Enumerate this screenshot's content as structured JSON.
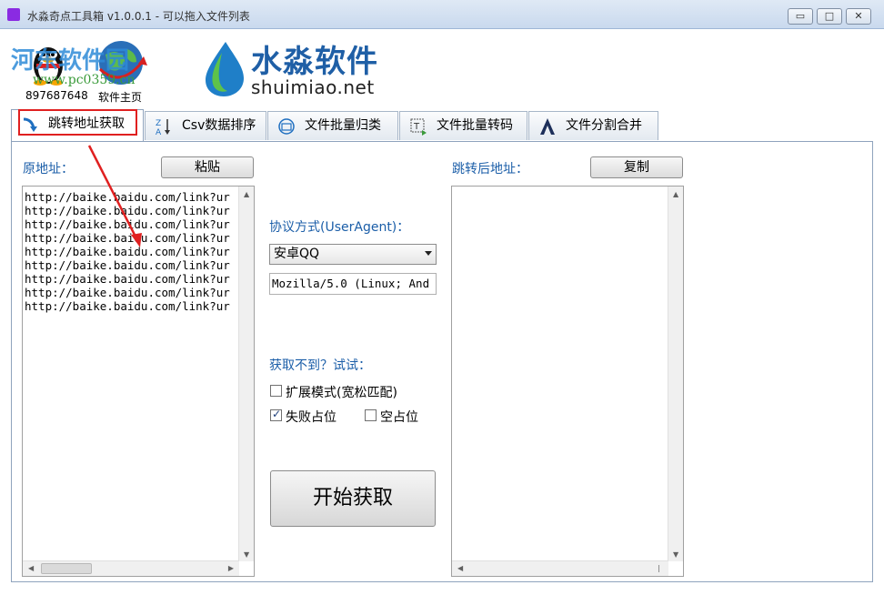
{
  "window": {
    "title": "水淼奇点工具箱 v1.0.0.1 - 可以拖入文件列表",
    "controls": {
      "minimize": "▭",
      "maximize": "□",
      "close": "✕"
    }
  },
  "header": {
    "watermark_title": "河东软件园",
    "watermark_url": "www.pc0359.cn",
    "qq_caption": "897687648",
    "home_caption": "软件主页",
    "logo_title": "水淼软件",
    "logo_subtitle": "shuimiao.net"
  },
  "tabs": [
    {
      "label": "跳转地址获取",
      "icon": "redirect-icon"
    },
    {
      "label": "Csv数据排序",
      "icon": "sort-az-icon"
    },
    {
      "label": "文件批量归类",
      "icon": "classify-icon"
    },
    {
      "label": "文件批量转码",
      "icon": "transcode-icon"
    },
    {
      "label": "文件分割合并",
      "icon": "split-merge-icon"
    }
  ],
  "left_panel": {
    "label": "原地址：",
    "paste_button": "粘贴",
    "urls": [
      "http://baike.baidu.com/link?ur",
      "http://baike.baidu.com/link?ur",
      "http://baike.baidu.com/link?ur",
      "http://baike.baidu.com/link?ur",
      "http://baike.baidu.com/link?ur",
      "http://baike.baidu.com/link?ur",
      "http://baike.baidu.com/link?ur",
      "http://baike.baidu.com/link?ur",
      "http://baike.baidu.com/link?ur"
    ]
  },
  "middle_panel": {
    "ua_label": "协议方式(UserAgent)：",
    "ua_selected": "安卓QQ",
    "ua_string": "Mozilla/5.0 (Linux; And",
    "retry_label": "获取不到？试试：",
    "extend_mode_label": "扩展模式(宽松匹配)",
    "extend_mode_checked": false,
    "fail_placeholder_label": "失败占位",
    "fail_placeholder_checked": true,
    "empty_placeholder_label": "空占位",
    "empty_placeholder_checked": false,
    "start_button": "开始获取"
  },
  "right_panel": {
    "label": "跳转后地址：",
    "copy_button": "复制"
  },
  "colors": {
    "label_blue": "#1b5ea8",
    "logo_blue": "#1f5fa6",
    "highlight_red": "#e02020"
  }
}
